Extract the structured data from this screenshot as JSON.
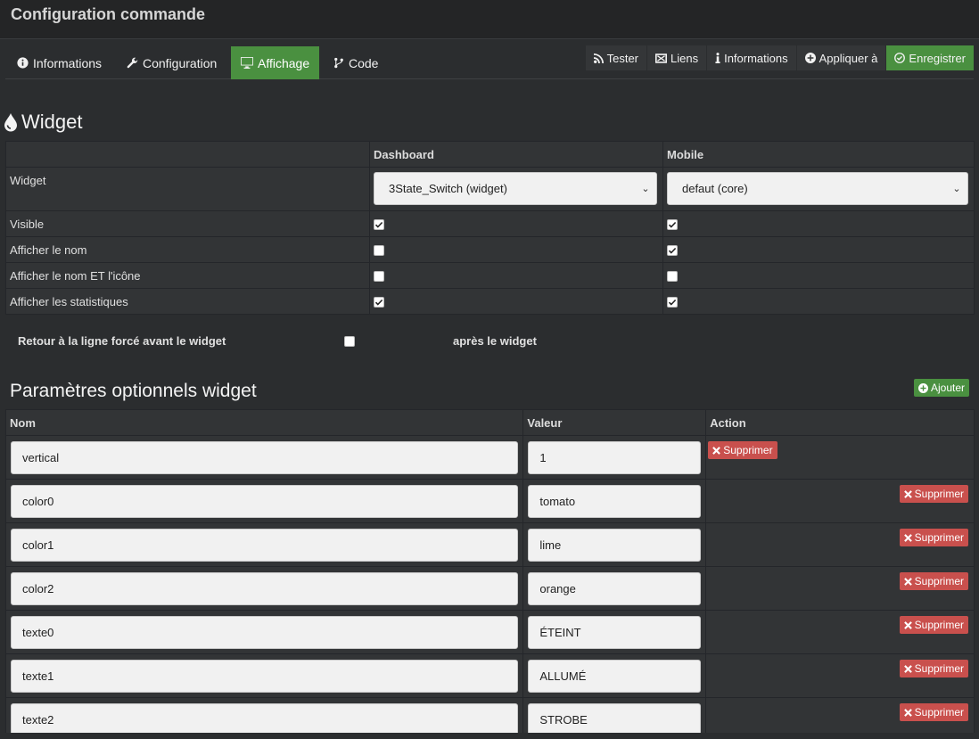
{
  "window": {
    "title": "Configuration commande"
  },
  "tabs": [
    {
      "label": "Informations",
      "icon": "info-circle-icon"
    },
    {
      "label": "Configuration",
      "icon": "wrench-icon"
    },
    {
      "label": "Affichage",
      "icon": "monitor-icon",
      "active": true
    },
    {
      "label": "Code",
      "icon": "branch-icon"
    }
  ],
  "actions": [
    {
      "label": "Tester",
      "icon": "rss-icon"
    },
    {
      "label": "Liens",
      "icon": "links-icon"
    },
    {
      "label": "Informations",
      "icon": "info-icon"
    },
    {
      "label": "Appliquer à",
      "icon": "plus-circle-icon"
    },
    {
      "label": "Enregistrer",
      "icon": "check-circle-icon"
    }
  ],
  "widget_section": {
    "title": "Widget",
    "col_dashboard": "Dashboard",
    "col_mobile": "Mobile",
    "widget_label": "Widget",
    "dashboard_widget": "3State_Switch (widget)",
    "mobile_widget": "defaut (core)",
    "rows": [
      {
        "label": "Visible",
        "dashboard": true,
        "mobile": true
      },
      {
        "label": "Afficher le nom",
        "dashboard": false,
        "mobile": true
      },
      {
        "label": "Afficher le nom ET l'icône",
        "dashboard": false,
        "mobile": false
      },
      {
        "label": "Afficher les statistiques",
        "dashboard": true,
        "mobile": true
      }
    ],
    "newline_before": "Retour à la ligne forcé avant le widget",
    "newline_before_checked": false,
    "newline_after": "après le widget"
  },
  "params": {
    "title": "Paramètres optionnels widget",
    "add_label": "Ajouter",
    "col_name": "Nom",
    "col_value": "Valeur",
    "col_action": "Action",
    "delete_label": "Supprimer",
    "rows": [
      {
        "name": "vertical",
        "value": "1"
      },
      {
        "name": "color0",
        "value": "tomato"
      },
      {
        "name": "color1",
        "value": "lime"
      },
      {
        "name": "color2",
        "value": "orange"
      },
      {
        "name": "texte0",
        "value": "ÉTEINT"
      },
      {
        "name": "texte1",
        "value": "ALLUMÉ"
      },
      {
        "name": "texte2",
        "value": "STROBE"
      }
    ]
  },
  "colors": {
    "accent_green": "#4a9040",
    "danger_red": "#c9504d",
    "background": "#2b2d2f"
  }
}
